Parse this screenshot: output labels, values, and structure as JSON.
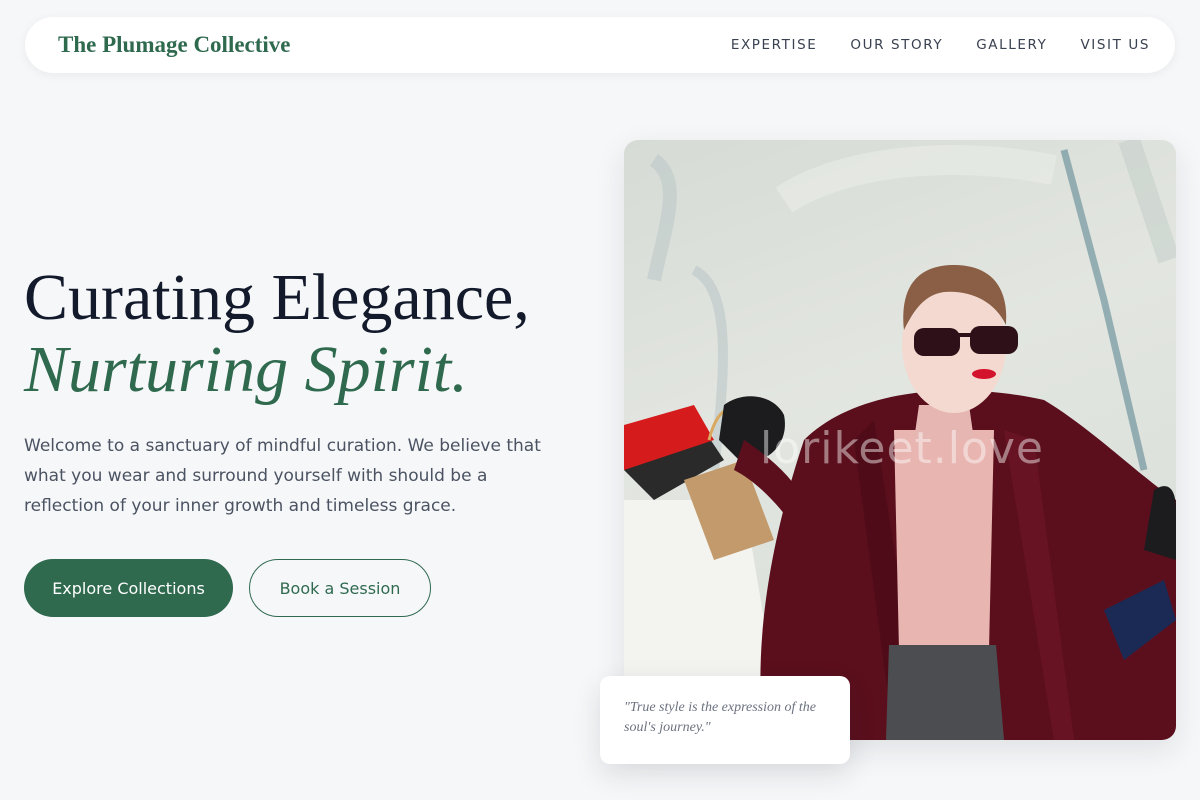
{
  "nav": {
    "brand": "The Plumage Collective",
    "links": [
      "EXPERTISE",
      "OUR STORY",
      "GALLERY",
      "VISIT US"
    ]
  },
  "hero": {
    "title_line1": "Curating Elegance,",
    "title_line2": "Nurturing Spirit.",
    "description": "Welcome to a sanctuary of mindful curation. We believe that what you wear and surround yourself with should be a reflection of your inner growth and timeless grace.",
    "primary_button": "Explore Collections",
    "secondary_button": "Book a Session"
  },
  "image": {
    "watermark": "lorikeet.love"
  },
  "quote": {
    "text": "\"True style is the expression of the soul's journey.\""
  },
  "colors": {
    "accent": "#2f6a4f",
    "background": "#f6f7f9",
    "heading": "#131a2b",
    "body_text": "#4b5362"
  },
  "icons": []
}
